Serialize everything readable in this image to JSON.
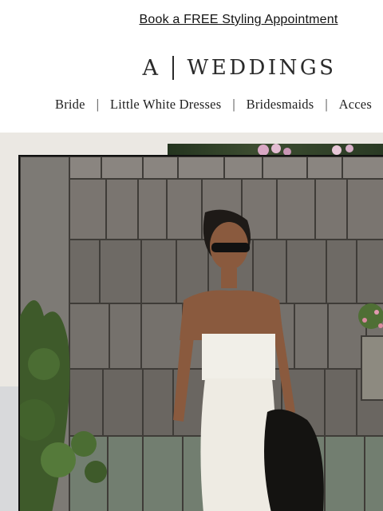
{
  "promo": {
    "text": "Book a FREE Styling Appointment"
  },
  "logo": {
    "letter": "A",
    "word": "WEDDINGS"
  },
  "nav": {
    "items": [
      "Bride",
      "Little White Dresses",
      "Bridesmaids",
      "Acces"
    ],
    "separator": "|"
  },
  "hero": {
    "image_description": "photo"
  }
}
